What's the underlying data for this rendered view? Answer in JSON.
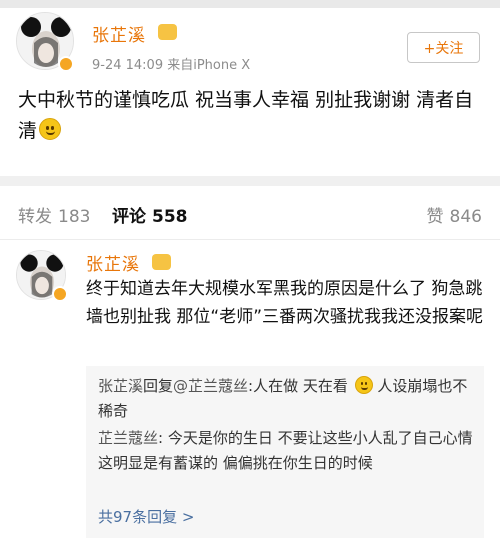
{
  "post": {
    "author": "张芷溪",
    "meta": "9-24 14:09  来自iPhone X",
    "follow_label": "+关注",
    "text": "大中秋节的谨慎吃瓜 祝当事人幸福 别扯我谢谢 清者自清"
  },
  "tabs": {
    "repost_label": "转发",
    "repost_count": "183",
    "comment_label": "评论",
    "comment_count": "558",
    "like_label": "赞",
    "like_count": "846"
  },
  "comment": {
    "author": "张芷溪",
    "text": "终于知道去年大规模水军黑我的原因是什么了 狗急跳墙也别扯我 那位“老师”三番两次骚扰我我还没报案呢"
  },
  "replies": [
    {
      "author": "张芷溪",
      "connector": "回复",
      "mention": "@芷兰蔻丝",
      "text_before": ":人在做 天在看",
      "text_after": " 人设崩塌也不稀奇"
    },
    {
      "author": "芷兰蔻丝",
      "text": ": 今天是你的生日  不要让这些小人乱了自己心情  这明显是有蓄谋的  偏偏挑在你生日的时候"
    }
  ],
  "more_replies": "共97条回复 >",
  "icons": {
    "avatar": "avatar-mickey-ears",
    "verified_badge": "verified-badge-icon",
    "vip_crown": "vip-crown-icon",
    "emoji": "smile-emoji-icon"
  },
  "colors": {
    "name_orange": "#e8760a",
    "link_blue": "#4a6fa0",
    "badge": "#f5a623"
  }
}
